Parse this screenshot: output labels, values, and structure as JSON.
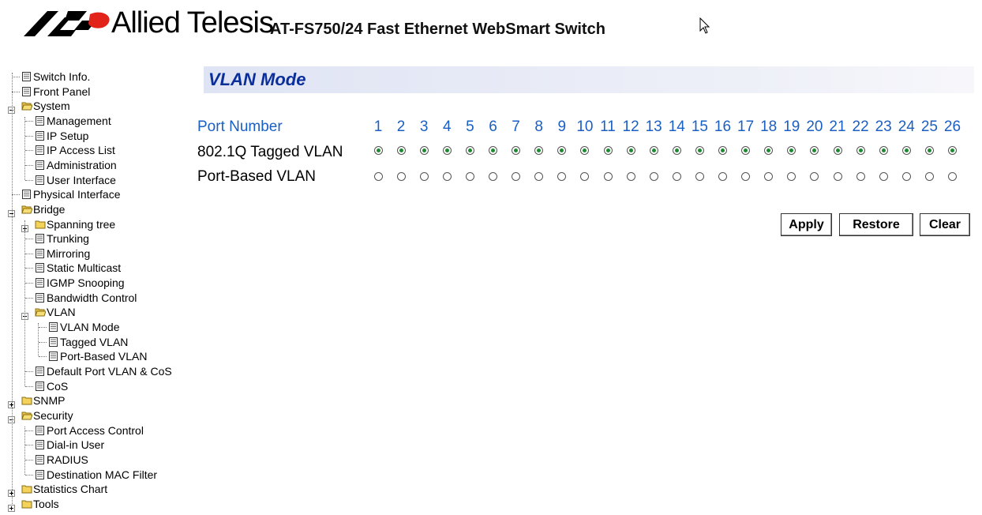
{
  "header": {
    "brand": "Allied Telesis",
    "product": "AT-FS750/24 Fast Ethernet WebSmart Switch"
  },
  "nav": {
    "items": [
      {
        "label": "Switch Info.",
        "type": "page",
        "level": 0
      },
      {
        "label": "Front Panel",
        "type": "page",
        "level": 0
      },
      {
        "label": "System",
        "type": "folder-open",
        "level": 0
      },
      {
        "label": "Management",
        "type": "page",
        "level": 1
      },
      {
        "label": "IP Setup",
        "type": "page",
        "level": 1
      },
      {
        "label": "IP Access List",
        "type": "page",
        "level": 1
      },
      {
        "label": "Administration",
        "type": "page",
        "level": 1
      },
      {
        "label": "User Interface",
        "type": "page",
        "level": 1
      },
      {
        "label": "Physical Interface",
        "type": "page",
        "level": 0
      },
      {
        "label": "Bridge",
        "type": "folder-open",
        "level": 0
      },
      {
        "label": "Spanning tree",
        "type": "folder-closed",
        "level": 1
      },
      {
        "label": "Trunking",
        "type": "page",
        "level": 1
      },
      {
        "label": "Mirroring",
        "type": "page",
        "level": 1
      },
      {
        "label": "Static Multicast",
        "type": "page",
        "level": 1
      },
      {
        "label": "IGMP Snooping",
        "type": "page",
        "level": 1
      },
      {
        "label": "Bandwidth Control",
        "type": "page",
        "level": 1
      },
      {
        "label": "VLAN",
        "type": "folder-open",
        "level": 1
      },
      {
        "label": "VLAN Mode",
        "type": "page",
        "level": 2
      },
      {
        "label": "Tagged VLAN",
        "type": "page",
        "level": 2
      },
      {
        "label": "Port-Based VLAN",
        "type": "page",
        "level": 2
      },
      {
        "label": "Default Port VLAN & CoS",
        "type": "page",
        "level": 1
      },
      {
        "label": "CoS",
        "type": "page",
        "level": 1
      },
      {
        "label": "SNMP",
        "type": "folder-closed",
        "level": 0
      },
      {
        "label": "Security",
        "type": "folder-open",
        "level": 0
      },
      {
        "label": "Port Access Control",
        "type": "page",
        "level": 1
      },
      {
        "label": "Dial-in User",
        "type": "page",
        "level": 1
      },
      {
        "label": "RADIUS",
        "type": "page",
        "level": 1
      },
      {
        "label": "Destination MAC Filter",
        "type": "page",
        "level": 1
      },
      {
        "label": "Statistics Chart",
        "type": "folder-closed",
        "level": 0
      },
      {
        "label": "Tools",
        "type": "folder-closed",
        "level": 0
      }
    ]
  },
  "main": {
    "title": "VLAN Mode",
    "port_number_label": "Port Number",
    "tagged_label": "802.1Q Tagged VLAN",
    "portbased_label": "Port-Based VLAN",
    "ports": [
      "1",
      "2",
      "3",
      "4",
      "5",
      "6",
      "7",
      "8",
      "9",
      "10",
      "11",
      "12",
      "13",
      "14",
      "15",
      "16",
      "17",
      "18",
      "19",
      "20",
      "21",
      "22",
      "23",
      "24",
      "25",
      "26"
    ],
    "selected_mode": "802.1Q Tagged VLAN",
    "buttons": {
      "apply": "Apply",
      "restore": "Restore",
      "clear": "Clear"
    }
  },
  "colors": {
    "accent_blue": "#1a5fc4",
    "title_blue": "#0a2f9a",
    "logo_red": "#e2231a",
    "radio_green": "#1c8a2e"
  }
}
